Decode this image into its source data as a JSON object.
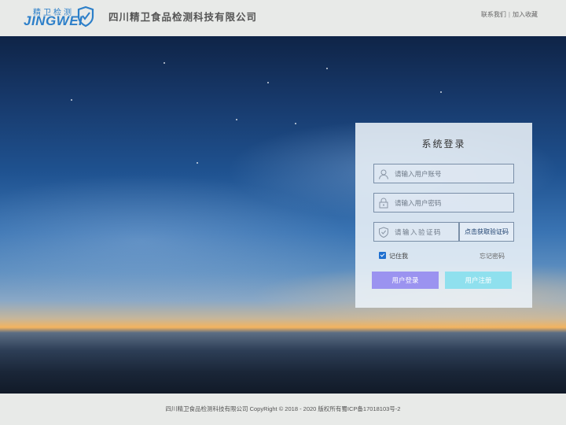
{
  "header": {
    "logo_cn": "精卫检测",
    "logo_en": "JINGWEI",
    "company_name": "四川精卫食品检测科技有限公司",
    "contact_link": "联系我们",
    "separator": "|",
    "favorite_link": "加入收藏"
  },
  "login": {
    "title": "系统登录",
    "username_placeholder": "请输入用户账号",
    "password_placeholder": "请输入用户密码",
    "captcha_placeholder": "请输入验证码",
    "captcha_button": "点击获取验证码",
    "remember_label": "记住我",
    "remember_checked": true,
    "forgot_link": "忘记密码",
    "login_button": "用户登录",
    "register_button": "用户注册"
  },
  "footer": {
    "text": "四川精卫食品检测科技有限公司 CopyRight © 2018 - 2020  版权所有蜀ICP备17018103号-2"
  },
  "colors": {
    "brand_blue": "#2c7fc9",
    "login_button": "#9b93f0",
    "register_button": "#8fe0ee",
    "checkbox": "#1e6fd0"
  },
  "icons": [
    "shield-logo-icon",
    "user-icon",
    "lock-icon",
    "shield-check-icon",
    "checkbox-checked-icon"
  ]
}
